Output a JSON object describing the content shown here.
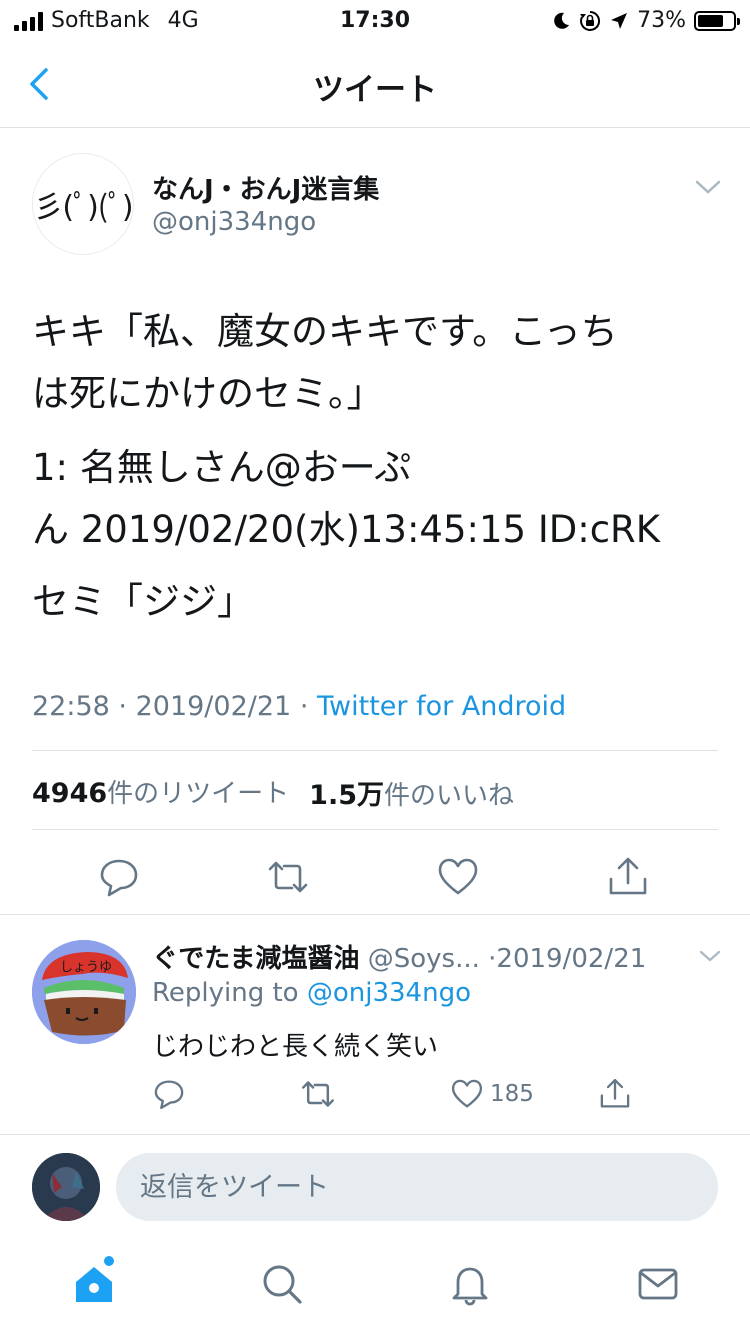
{
  "status_bar": {
    "carrier": "SoftBank",
    "network": "4G",
    "time": "17:30",
    "battery": "73%",
    "battery_level": 0.73,
    "icons": [
      "signal-icon",
      "moon-icon",
      "rotation-lock-icon",
      "location-arrow-icon",
      "battery-icon"
    ]
  },
  "nav": {
    "title": "ツイート",
    "back_icon": "chevron-left-icon"
  },
  "tweet": {
    "avatar_text": "彡(ﾟ)(ﾟ)",
    "author_name": "なんJ・おんJ迷言集",
    "author_handle": "@onj334ngo",
    "text_lines": [
      "キキ「私、魔女のキキです。こっち",
      "は死にかけのセミ。」",
      "1: 名無しさん@おーぷ",
      "ん 2019/02/20(水)13:45:15 ID:cRK",
      "セミ「ジジ」"
    ],
    "time": "22:58",
    "date": "2019/02/21",
    "separator": "·",
    "client": "Twitter for Android",
    "retweet_count": "4946",
    "retweet_label": "件のリツイート",
    "like_count": "1.5万",
    "like_label": "件のいいね",
    "action_icons": [
      "reply-icon",
      "retweet-icon",
      "like-icon",
      "share-icon"
    ]
  },
  "reply": {
    "author_name": "ぐでたま減塩醤油",
    "author_handle": "@Soys...",
    "date": "·2019/02/21",
    "replying_prefix": "Replying to",
    "replying_to": "@onj334ngo",
    "text": "じわじわと長く続く笑い",
    "like_count": "185",
    "avatar_text": "しょうゆ"
  },
  "compose": {
    "placeholder": "返信をツイート"
  },
  "tabbar": {
    "items": [
      "home-icon",
      "search-icon",
      "notifications-icon",
      "messages-icon"
    ],
    "active": "home-icon"
  },
  "colors": {
    "accent": "#1da1f2",
    "link": "#1b95e0",
    "secondary_text": "#657786",
    "divider": "#dde2e6",
    "icon_gray": "#657786"
  }
}
